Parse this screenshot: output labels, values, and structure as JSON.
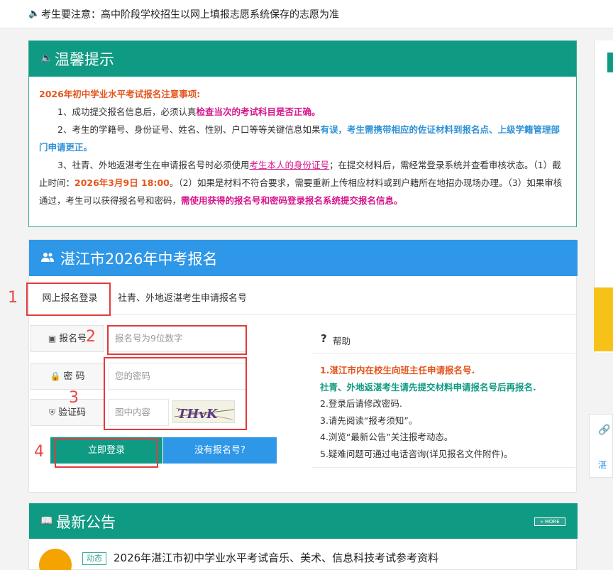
{
  "notice": {
    "icon": "speaker-icon",
    "text": "考生要注意：高中阶段学校招生以网上填报志愿系统保存的志愿为准"
  },
  "tips": {
    "title": "温馨提示",
    "heading": "2026年初中学业水平考试报名注意事项:",
    "p1_a": "1、成功提交报名信息后，必须认真",
    "p1_b": "检查当次的考试科目是否正确。",
    "p2_a": "2、考生的学籍号、身份证号、姓名、性别、户口等等关键信息如果",
    "p2_b": "有误，",
    "p2_c": "考生需携带相应的佐证材料到报名点、上级学籍管理部门申请更正。",
    "p3_a": "3、社青、外地返湛考生在申请报名号时必须使用",
    "p3_b": "考生本人的身份证号",
    "p3_c": "；在提交材料后，需经常登录系统并查看审核状态。（1）截止时间：",
    "p3_d": "2026年3月9日 18:00",
    "p3_e": "。（2）如果是材料不符合要求，需要重新上传相应材料或到户籍所在地招办现场办理。（3）如果审核通过，考生可以获得报名号和密码，",
    "p3_f": "需使用获得的报名号和密码登录报名系统提交报名信息。"
  },
  "register": {
    "title": "湛江市2026年中考报名",
    "tab_login": "网上报名登录",
    "tab_apply": "社青、外地返湛考生申请报名号",
    "label_id": "报名号",
    "placeholder_id": "报名号为9位数字",
    "label_pwd": "密 码",
    "placeholder_pwd": "您的密码",
    "label_captcha": "验证码",
    "placeholder_captcha": "图中内容",
    "captcha_text": "THvK",
    "btn_login": "立即登录",
    "btn_noreg": "没有报名号?",
    "help_title": "帮助",
    "help_1": "1.湛江市内在校生向班主任申请报名号.",
    "help_1b": "社青、外地返湛考生请先提交材料申请报名号后再报名.",
    "help_2": "2.登录后请修改密码.",
    "help_3": "3.请先阅读“报考须知”。",
    "help_4": "4.浏览“最新公告”关注报考动态。",
    "help_5": "5.疑难问题可通过电话咨询(详见报名文件附件)。"
  },
  "annotations": [
    "1",
    "2",
    "3",
    "4"
  ],
  "news": {
    "title": "最新公告",
    "more": "» MORE",
    "badge": "动态",
    "item1": "2026年湛江市初中学业水平考试音乐、美术、信息科技考试参考资料"
  },
  "side": {
    "link_text": "湛"
  },
  "colors": {
    "teal": "#0f9a83",
    "blue": "#2f97e8",
    "annotation_red": "#e23b3b"
  }
}
